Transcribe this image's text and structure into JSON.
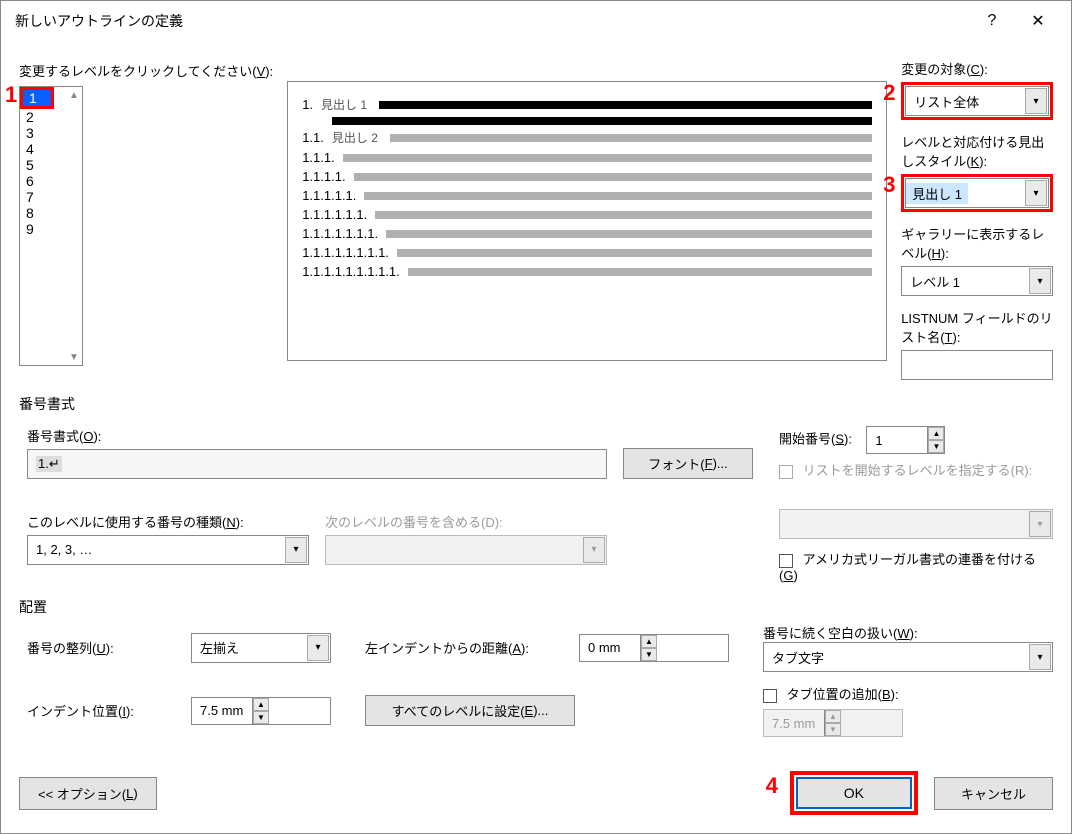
{
  "title": "新しいアウトラインの定義",
  "help_icon": "?",
  "close_icon": "✕",
  "pick_level_label_pre": "変更するレベルをクリックしてください(",
  "pick_level_key": "V",
  "pick_level_label_post": "):",
  "levels": [
    "1",
    "2",
    "3",
    "4",
    "5",
    "6",
    "7",
    "8",
    "9"
  ],
  "preview": {
    "rows": [
      {
        "num": "1.",
        "heading": "見出し 1",
        "style": "black"
      },
      {
        "style": "black"
      },
      {
        "num": "1.1.",
        "heading": "見出し 2",
        "style": "grey"
      },
      {
        "num": "1.1.1.",
        "style": "grey"
      },
      {
        "num": "1.1.1.1.",
        "style": "grey"
      },
      {
        "num": "1.1.1.1.1.",
        "style": "grey"
      },
      {
        "num": "1.1.1.1.1.1.",
        "style": "grey"
      },
      {
        "num": "1.1.1.1.1.1.1.",
        "style": "grey"
      },
      {
        "num": "1.1.1.1.1.1.1.1.",
        "style": "grey"
      },
      {
        "num": "1.1.1.1.1.1.1.1.1.",
        "style": "grey"
      }
    ]
  },
  "target_label_pre": "変更の対象(",
  "target_key": "C",
  "target_label_post": "):",
  "target_value": "リスト全体",
  "heading_style_label_pre": "レベルと対応付ける見出しスタイル(",
  "heading_style_key": "K",
  "heading_style_label_post": "):",
  "heading_style_value": "見出し 1",
  "gallery_label_pre": "ギャラリーに表示するレベル(",
  "gallery_key": "H",
  "gallery_label_post": "):",
  "gallery_value": "レベル 1",
  "listnum_label_pre": "LISTNUM フィールドのリスト名(",
  "listnum_key": "T",
  "listnum_label_post": "):",
  "listnum_value": "",
  "numfmt_section": "番号書式",
  "numfmt_label_pre": "番号書式(",
  "numfmt_key": "O",
  "numfmt_label_post": "):",
  "numfmt_value": "1.↵",
  "font_btn_pre": "フォント(",
  "font_key": "F",
  "font_btn_post": ")...",
  "numtype_label_pre": "このレベルに使用する番号の種類(",
  "numtype_key": "N",
  "numtype_label_post": "):",
  "numtype_value": "1, 2, 3, …",
  "include_label": "次のレベルの番号を含める(D):",
  "startnum_label_pre": "開始番号(",
  "startnum_key": "S",
  "startnum_label_post": "):",
  "startnum_value": "1",
  "restart_label": "リストを開始するレベルを指定する(R):",
  "legal_label_pre": "アメリカ式リーガル書式の連番を付ける(",
  "legal_key": "G",
  "legal_label_post": ")",
  "pos_section": "配置",
  "align_label_pre": "番号の整列(",
  "align_key": "U",
  "align_label_post": "):",
  "align_value": "左揃え",
  "from_left_label_pre": "左インデントからの距離(",
  "from_left_key": "A",
  "from_left_label_post": "):",
  "from_left_value": "0 mm",
  "indent_label_pre": "インデント位置(",
  "indent_key": "I",
  "indent_label_post": "):",
  "indent_value": "7.5 mm",
  "set_all_pre": "すべてのレベルに設定(",
  "set_all_key": "E",
  "set_all_post": ")...",
  "follow_label_pre": "番号に続く空白の扱い(",
  "follow_key": "W",
  "follow_label_post": "):",
  "follow_value": "タブ文字",
  "tabstop_label_pre": "タブ位置の追加(",
  "tabstop_key": "B",
  "tabstop_label_post": "):",
  "tabstop_value": "7.5 mm",
  "options_btn_pre": "<< オプション(",
  "options_key": "L",
  "options_btn_post": ")",
  "ok": "OK",
  "cancel": "キャンセル",
  "callouts": {
    "1": "1",
    "2": "2",
    "3": "3",
    "4": "4"
  }
}
